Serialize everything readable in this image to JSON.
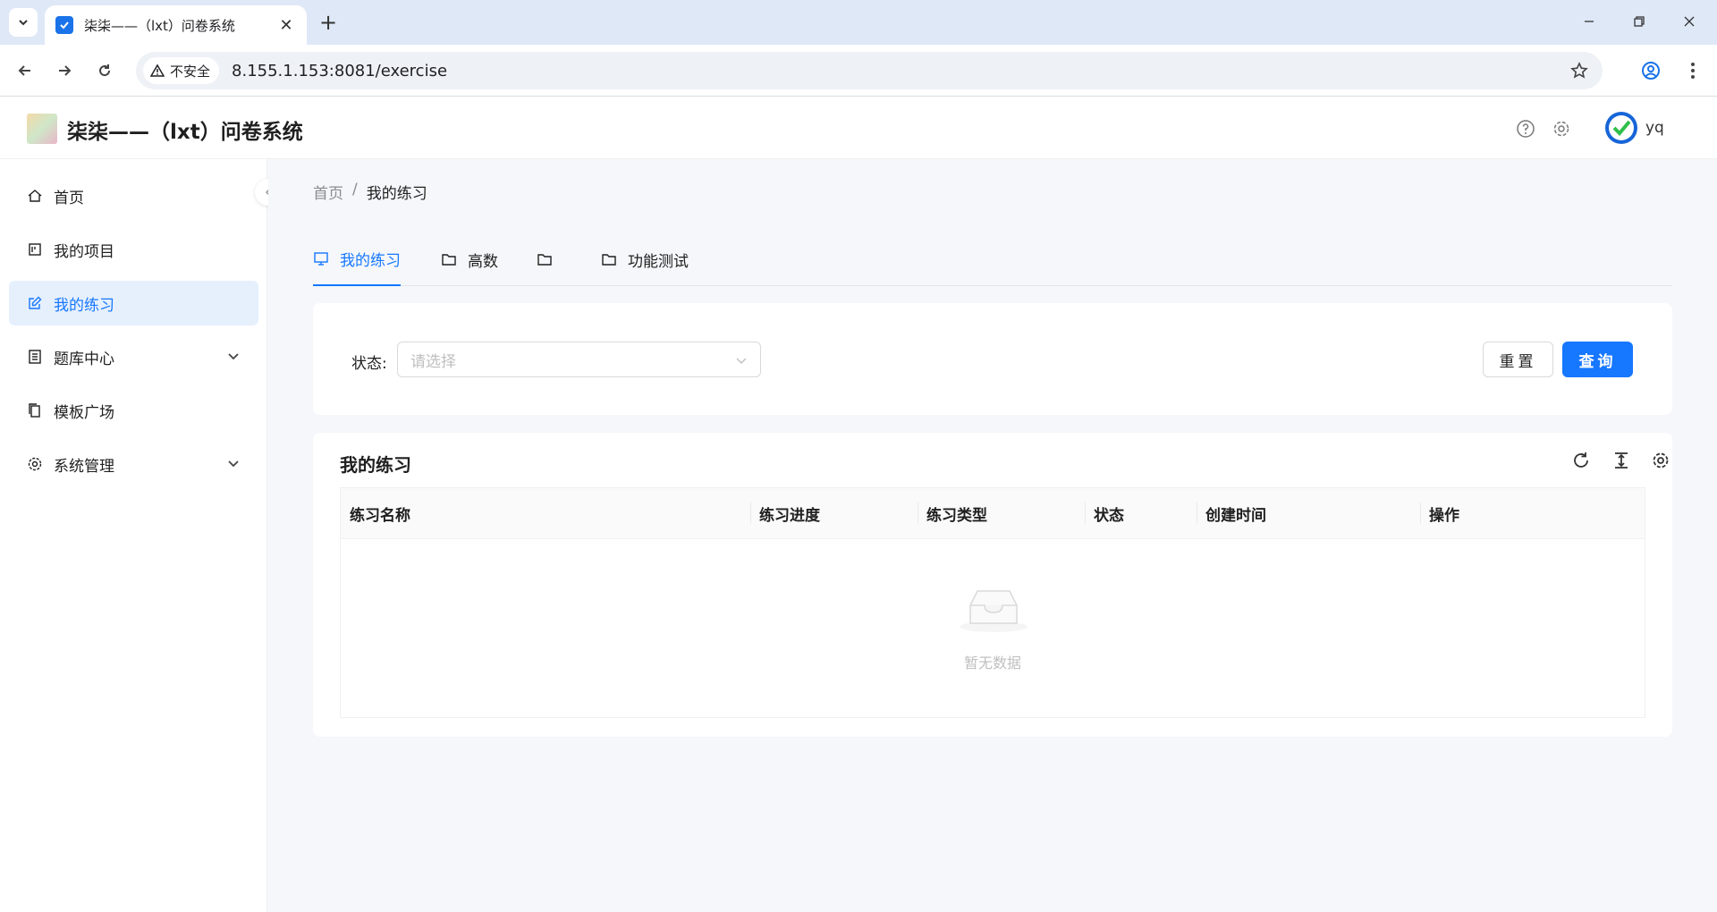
{
  "browser": {
    "tab_title": "柒柒——（lxt）问卷系统",
    "security_label": "不安全",
    "url": "8.155.1.153:8081/exercise"
  },
  "header": {
    "title": "柒柒——（lxt）问卷系统",
    "username": "yq"
  },
  "sidebar": {
    "items": [
      {
        "label": "首页",
        "icon": "home-icon"
      },
      {
        "label": "我的项目",
        "icon": "project-icon"
      },
      {
        "label": "我的练习",
        "icon": "edit-icon",
        "active": true
      },
      {
        "label": "题库中心",
        "icon": "book-icon",
        "expandable": true
      },
      {
        "label": "模板广场",
        "icon": "copy-icon"
      },
      {
        "label": "系统管理",
        "icon": "gear-icon",
        "expandable": true
      }
    ]
  },
  "breadcrumb": {
    "home": "首页",
    "separator": "/",
    "current": "我的练习"
  },
  "tabs": [
    {
      "label": "我的练习",
      "icon": "monitor-icon",
      "active": true
    },
    {
      "label": "高数",
      "icon": "folder-icon"
    },
    {
      "label": "",
      "icon": "folder-icon"
    },
    {
      "label": "功能测试",
      "icon": "folder-icon"
    }
  ],
  "filter": {
    "status_label": "状态:",
    "status_placeholder": "请选择",
    "reset_label": "重置",
    "query_label": "查询"
  },
  "table": {
    "title": "我的练习",
    "columns": [
      "练习名称",
      "练习进度",
      "练习类型",
      "状态",
      "创建时间",
      "操作"
    ],
    "rows": [],
    "empty_text": "暂无数据"
  },
  "colors": {
    "accent": "#1677ff",
    "active_bg": "#e6f0fd"
  }
}
